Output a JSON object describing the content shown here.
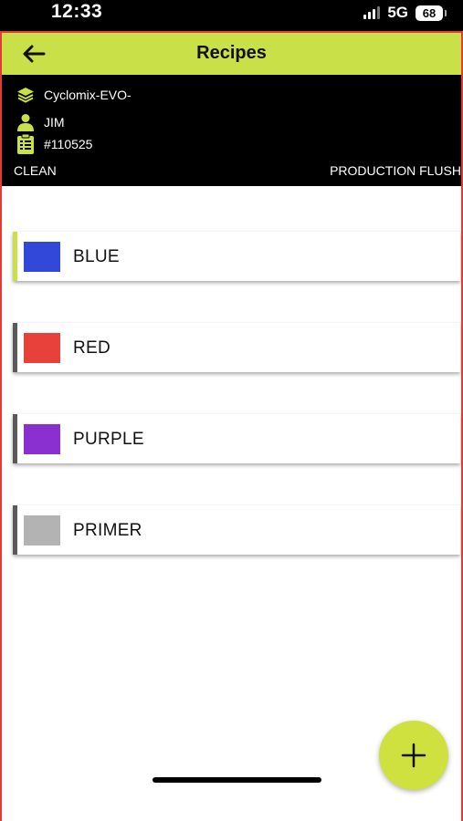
{
  "status_bar": {
    "time": "12:33",
    "network": "5G",
    "battery": "68"
  },
  "app_bar": {
    "title": "Recipes",
    "back_icon": "arrow-left-icon",
    "color": "#c9e048"
  },
  "info": {
    "machine": "Cyclomix-EVO-",
    "machine_icon": "layers-icon",
    "user": "JIM",
    "user_icon": "person-icon",
    "order": "#110525",
    "order_icon": "clipboard-icon",
    "mode_left": "CLEAN",
    "mode_right": "PRODUCTION FLUSH"
  },
  "recipes": [
    {
      "name": "BLUE",
      "swatch": "#3248d8",
      "accent": "#c9e048"
    },
    {
      "name": "RED",
      "swatch": "#e8413a",
      "accent": "#5a5a5a"
    },
    {
      "name": "PURPLE",
      "swatch": "#8a2fd0",
      "accent": "#5a5a5a"
    },
    {
      "name": "PRIMER",
      "swatch": "#b3b3b3",
      "accent": "#5a5a5a"
    }
  ],
  "fab": {
    "icon": "plus-icon",
    "color": "#cfe13f"
  },
  "colors": {
    "frame_border": "#e53935"
  }
}
